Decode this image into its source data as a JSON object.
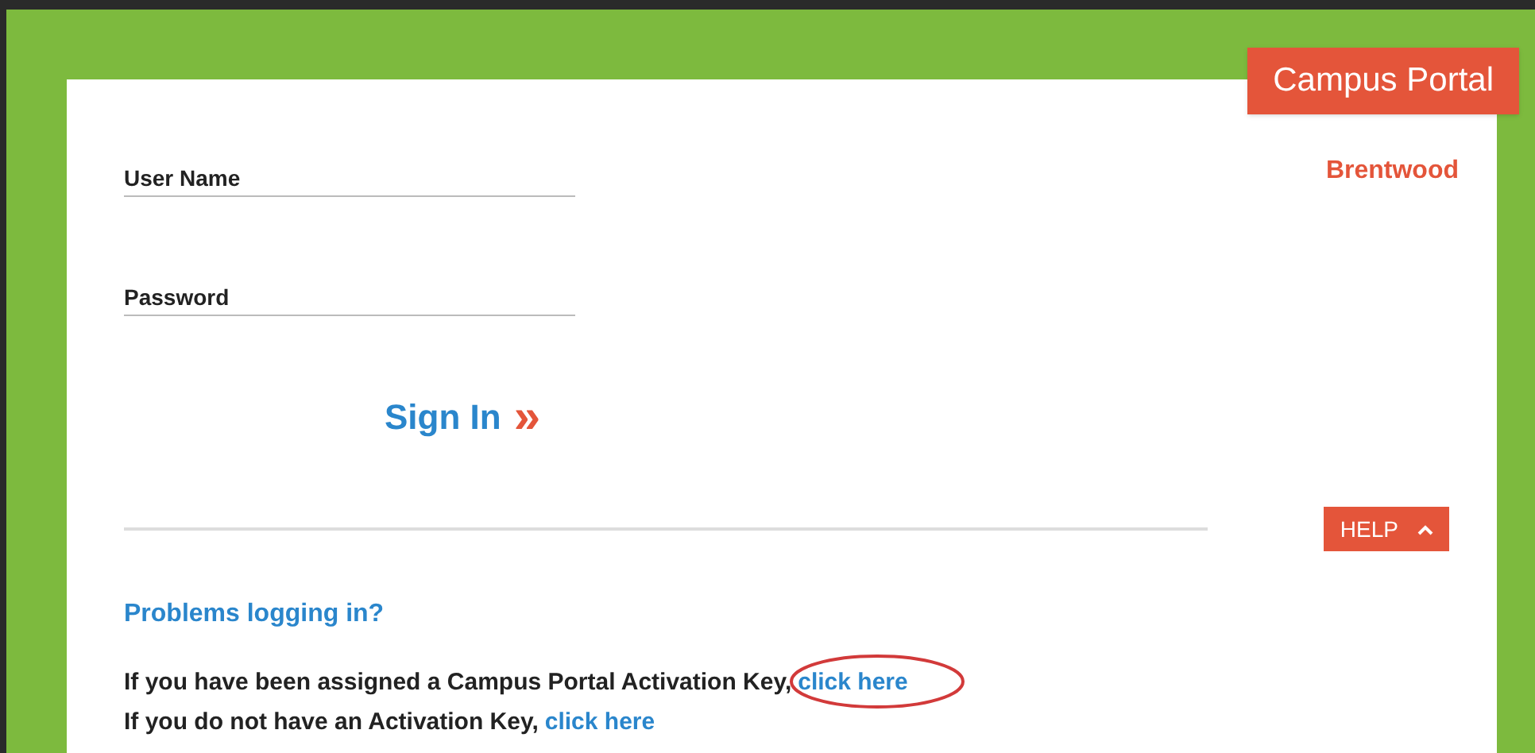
{
  "ribbon": {
    "title": "Campus Portal"
  },
  "district": "Brentwood",
  "fields": [
    {
      "label": "User Name"
    },
    {
      "label": "Password"
    }
  ],
  "sign_in": {
    "label": "Sign In",
    "icon": "»"
  },
  "help_button": {
    "label": "HELP",
    "expanded": true
  },
  "problems_link": "Problems logging in?",
  "activation_lines": [
    {
      "text": "If you have been assigned a Campus Portal Activation Key,",
      "link": "click here",
      "circled": true
    },
    {
      "text": "If you do not have an Activation Key,",
      "link": "click here",
      "circled": false
    }
  ]
}
